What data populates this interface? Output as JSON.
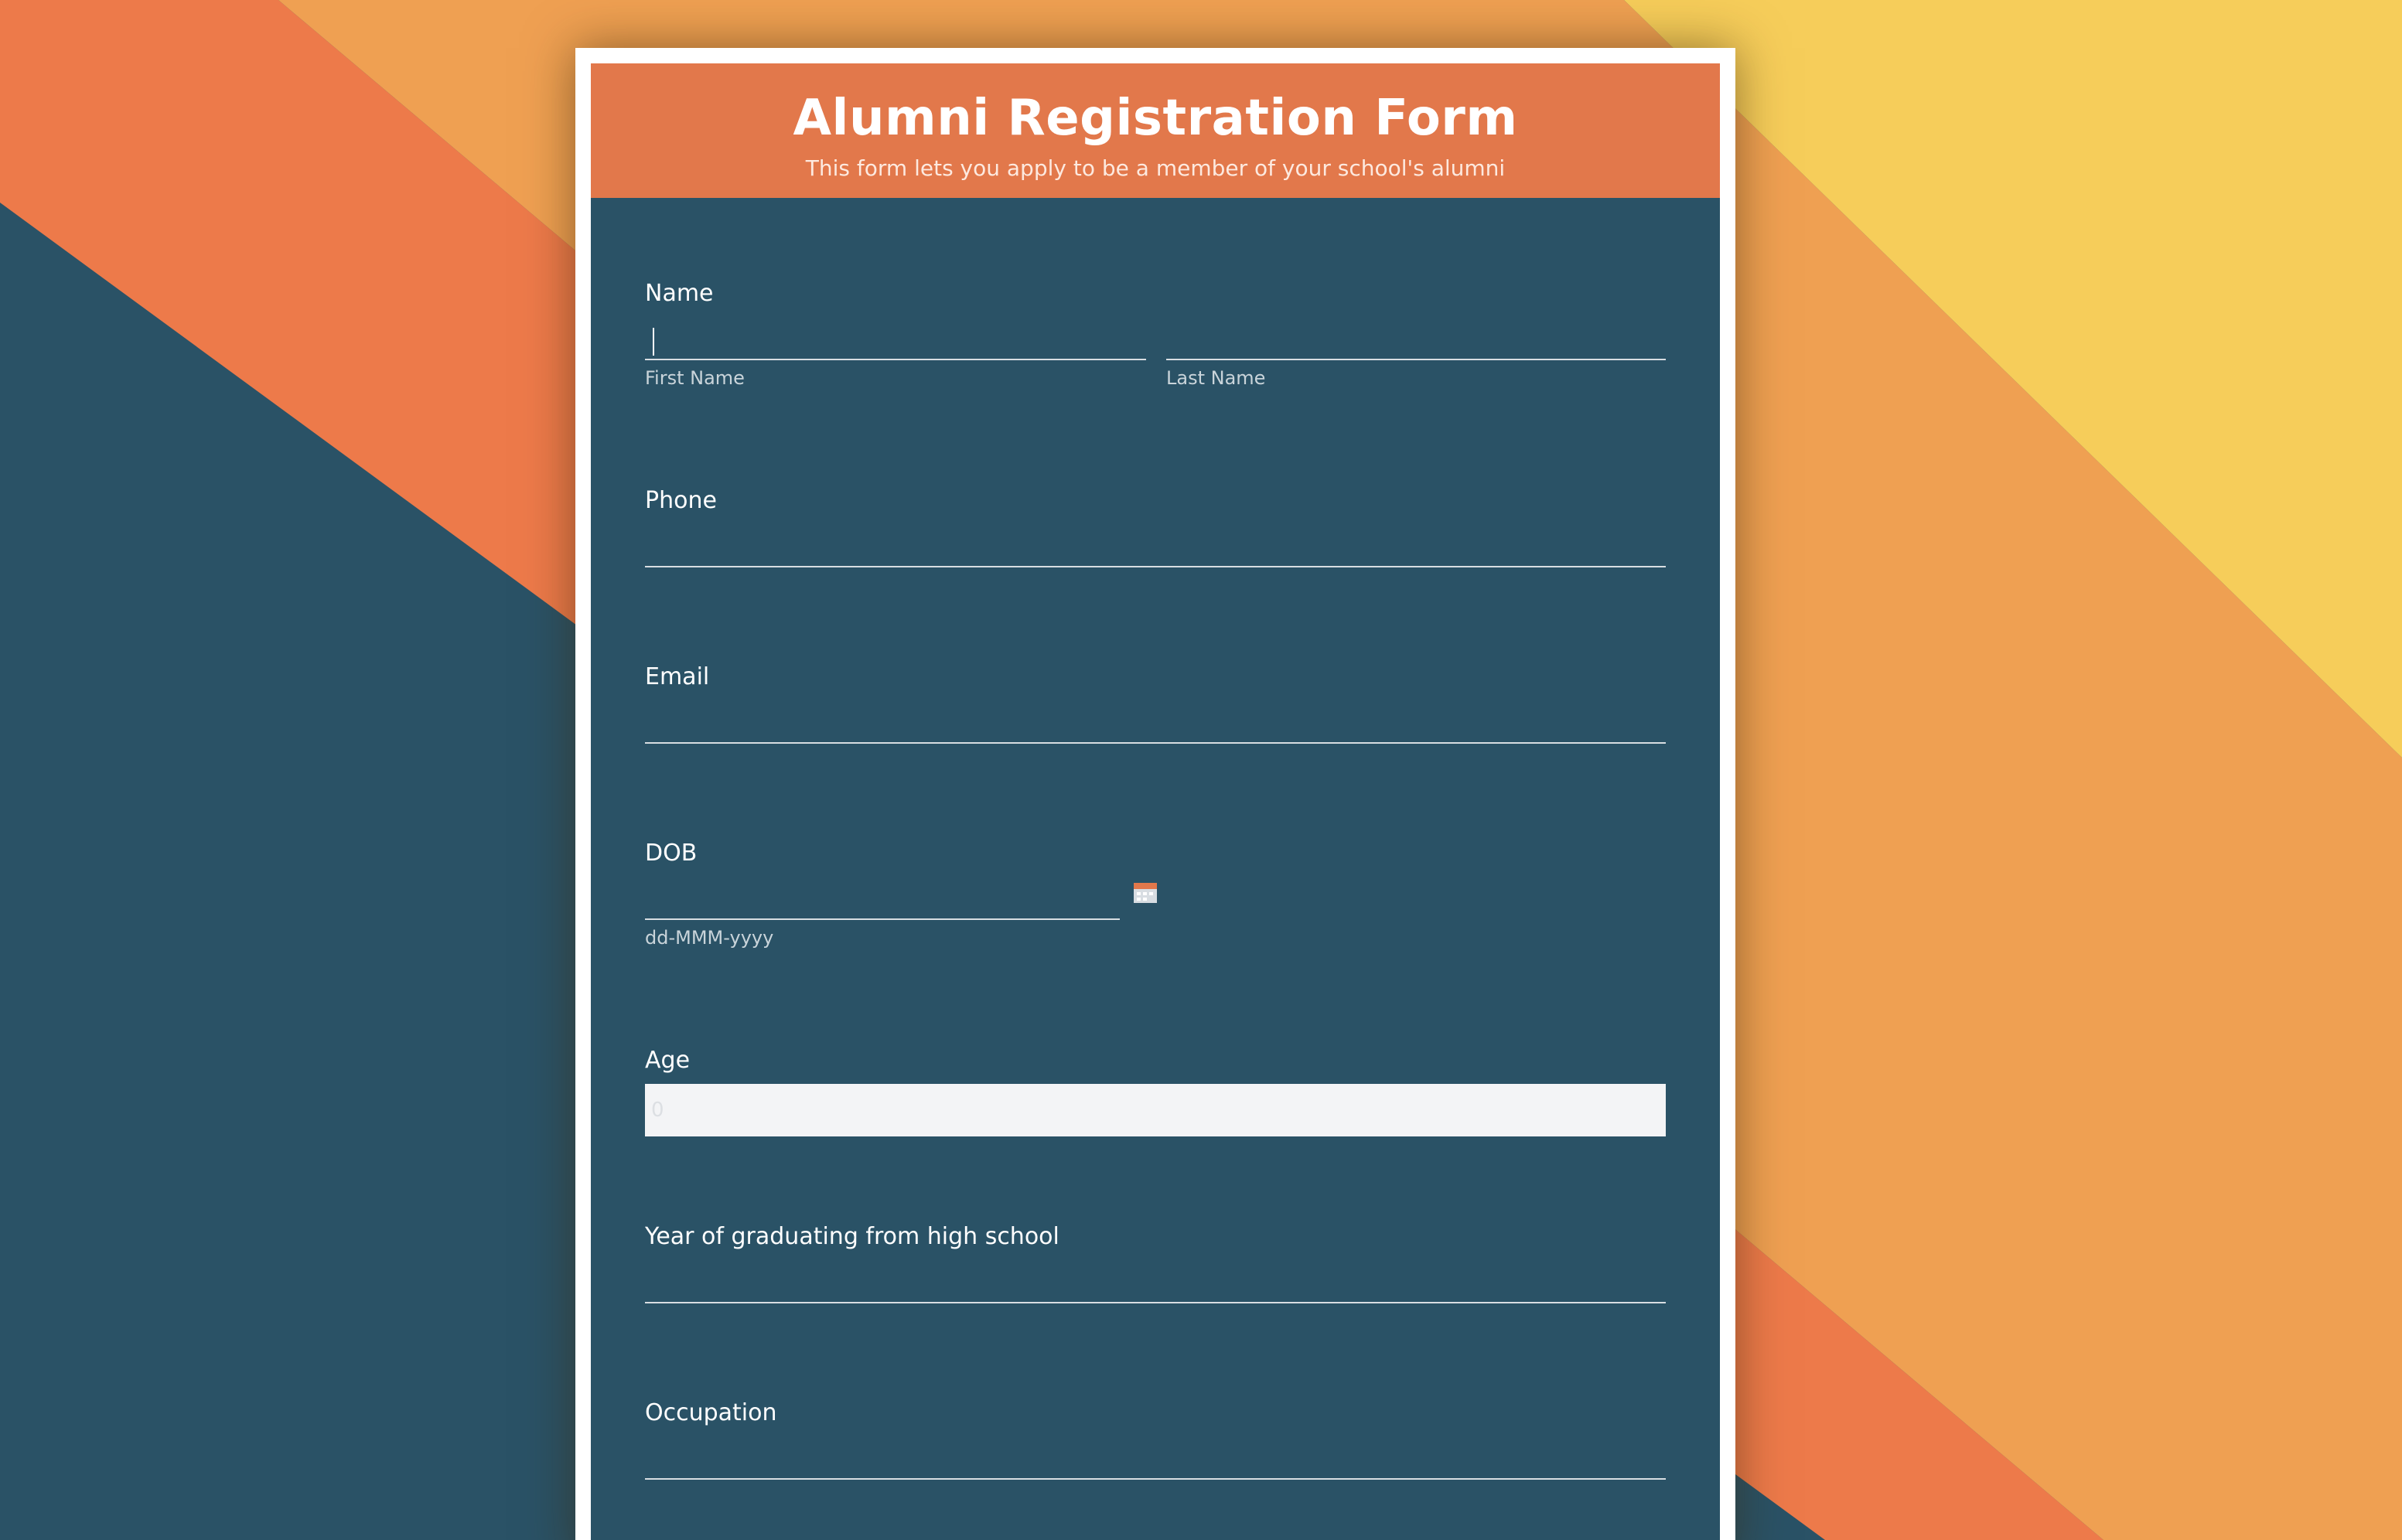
{
  "colors": {
    "navy": "#2a5266",
    "orange": "#ed7a4a",
    "light_orange": "#efa052",
    "yellow": "#f6cd5a",
    "header": "#e2784b"
  },
  "form": {
    "title": "Alumni Registration Form",
    "subtitle": "This form lets you apply to be a member of your school's alumni"
  },
  "fields": {
    "name": {
      "label": "Name",
      "first_sublabel": "First Name",
      "last_sublabel": "Last Name",
      "first_value": "",
      "last_value": ""
    },
    "phone": {
      "label": "Phone",
      "value": ""
    },
    "email": {
      "label": "Email",
      "value": ""
    },
    "dob": {
      "label": "DOB",
      "format_hint": "dd-MMM-yyyy",
      "icon": "calendar-icon",
      "value": ""
    },
    "age": {
      "label": "Age",
      "value": "0"
    },
    "graduation_year": {
      "label": "Year of graduating from high school",
      "value": ""
    },
    "occupation": {
      "label": "Occupation",
      "value": ""
    }
  }
}
